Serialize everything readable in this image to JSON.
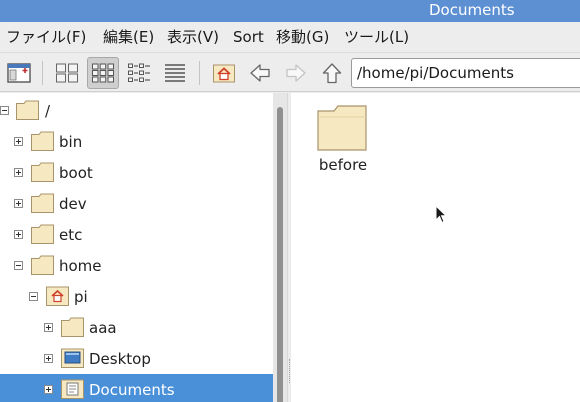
{
  "window": {
    "title": "Documents"
  },
  "menubar": {
    "items": [
      {
        "label": "ファイル(F)"
      },
      {
        "label": "編集(E)"
      },
      {
        "label": "表示(V)"
      },
      {
        "label": "Sort"
      },
      {
        "label": "移動(G)"
      },
      {
        "label": "ツール(L)"
      }
    ]
  },
  "toolbar": {
    "path": "/home/pi/Documents",
    "buttons": [
      {
        "name": "toggle-sidepane-icon"
      },
      {
        "name": "icon-view-icon"
      },
      {
        "name": "thumbnail-view-icon",
        "active": true
      },
      {
        "name": "compact-view-icon"
      },
      {
        "name": "detailed-list-view-icon"
      },
      {
        "name": "home-icon"
      },
      {
        "name": "back-arrow-icon"
      },
      {
        "name": "forward-arrow-icon",
        "disabled": true
      },
      {
        "name": "up-arrow-icon"
      }
    ]
  },
  "tree": [
    {
      "label": "/",
      "expanded": true,
      "icon": "folder-icon"
    },
    {
      "label": "bin",
      "expanded": false,
      "icon": "folder-icon"
    },
    {
      "label": "boot",
      "expanded": false,
      "icon": "folder-icon"
    },
    {
      "label": "dev",
      "expanded": false,
      "icon": "folder-icon"
    },
    {
      "label": "etc",
      "expanded": false,
      "icon": "folder-icon"
    },
    {
      "label": "home",
      "expanded": true,
      "icon": "folder-icon"
    },
    {
      "label": "pi",
      "expanded": true,
      "icon": "home-folder-icon"
    },
    {
      "label": "aaa",
      "expanded": false,
      "icon": "folder-icon"
    },
    {
      "label": "Desktop",
      "expanded": false,
      "icon": "desktop-folder-icon"
    },
    {
      "label": "Documents",
      "expanded": false,
      "icon": "documents-folder-icon",
      "selected": true
    }
  ],
  "content": {
    "items": [
      {
        "label": "before",
        "icon": "folder-icon"
      }
    ]
  },
  "colors": {
    "titlebar": "#5d8fd3",
    "selection": "#4a90d9",
    "folder_fill": "#f6e9c2",
    "folder_stroke": "#a8946a"
  }
}
